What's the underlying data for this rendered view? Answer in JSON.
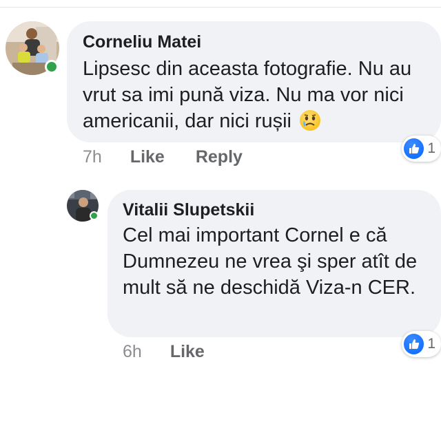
{
  "comments": [
    {
      "author": "Corneliu Matei",
      "text": "Lipsesc din aceasta fotografie. Nu au vrut sa imi pună viza. Nu ma vor nici americanii, dar nici rușii",
      "emoji": "crying-face",
      "time": "7h",
      "actions": [
        "Like",
        "Reply"
      ],
      "reaction_count": "1",
      "online": true
    },
    {
      "author": "Vitalii Slupetskii",
      "text": "Cel mai important Cornel e că Dumnezeu ne vrea şi sper atît de mult să ne deschidă Viza-n CER.",
      "time": "6h",
      "actions": [
        "Like"
      ],
      "reaction_count": "1",
      "online": true
    }
  ],
  "colors": {
    "bubble": "#f0f2f5",
    "online": "#31a24c",
    "like_blue": "#0866ff",
    "meta_text": "#65676b"
  },
  "icons": {
    "reaction": "thumbs-up-icon",
    "emoji": "crying-face-emoji-icon"
  }
}
